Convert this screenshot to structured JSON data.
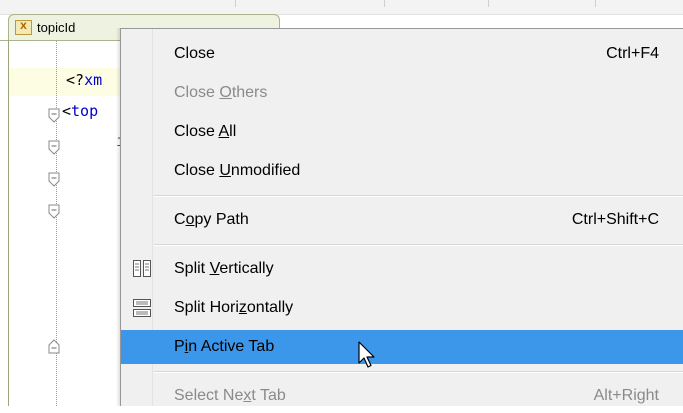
{
  "tab": {
    "title": "topicId",
    "icon": "xml-file-icon",
    "icon_text": "X"
  },
  "editor": {
    "line1": {
      "prefix": "<?",
      "keyword": "xm"
    },
    "line2": {
      "prefix": "<",
      "keyword": "top"
    },
    "line3": {
      "text": "i"
    }
  },
  "menu": {
    "close": {
      "label": "Close",
      "shortcut": "Ctrl+F4"
    },
    "close_others": {
      "pre": "Close ",
      "u": "O",
      "post": "thers"
    },
    "close_all": {
      "pre": "Close ",
      "u": "A",
      "post": "ll"
    },
    "close_unmodified": {
      "pre": "Close ",
      "u": "U",
      "post": "nmodified"
    },
    "copy_path": {
      "pre": "C",
      "u": "o",
      "post": "py Path",
      "shortcut": "Ctrl+Shift+C"
    },
    "split_vertically": {
      "pre": "Split ",
      "u": "V",
      "post": "ertically",
      "icon": "split-vertical-icon"
    },
    "split_horizontally": {
      "pre": "Split Hori",
      "u": "z",
      "post": "ontally",
      "icon": "split-horizontal-icon"
    },
    "pin_active_tab": {
      "pre": "P",
      "u": "i",
      "post": "n Active Tab"
    },
    "select_next_tab": {
      "pre": "Select Ne",
      "u": "x",
      "post": "t Tab",
      "shortcut": "Alt+Right"
    }
  },
  "colors": {
    "highlight": "#3c97ea",
    "menu_bg": "#f0f0f0",
    "disabled_text": "#8a8a8a",
    "keyword": "#0000c8"
  }
}
